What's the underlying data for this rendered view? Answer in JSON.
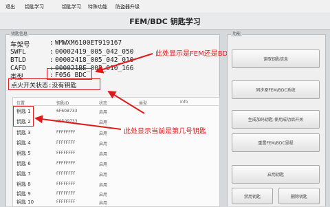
{
  "menu": {
    "item0": "退出",
    "item1": "钥匙学习",
    "item2": "钥匙学习",
    "item3": "特殊功能",
    "item4": "防盗器升级"
  },
  "window": {
    "title": "FEM/BDC 钥匙学习"
  },
  "info_group": {
    "label": "钥匙信息",
    "rows": [
      {
        "label": "车架号",
        "value": "WMWXM6100ET919167"
      },
      {
        "label": "SWFL",
        "value": "00002419_005_042_050"
      },
      {
        "label": "BTLD",
        "value": "00002418_005_042_010"
      },
      {
        "label": "CAFD",
        "value": "000021BE_005_010_166"
      },
      {
        "label": "类型",
        "value": "F056 BDC"
      }
    ],
    "switch_status": "点火开关状态:没有钥匙"
  },
  "key_table": {
    "headers": [
      "位置",
      "钥匙ID",
      "状态",
      "类型",
      "Info"
    ],
    "rows": [
      {
        "pos": "钥匙 1",
        "id": "6F60B733",
        "status": "启用"
      },
      {
        "pos": "钥匙 2",
        "id": "49509733",
        "status": "启用"
      },
      {
        "pos": "钥匙 3",
        "id": "FFFFFFFF",
        "status": "启用"
      },
      {
        "pos": "钥匙 4",
        "id": "FFFFFFFF",
        "status": "启用"
      },
      {
        "pos": "钥匙 5",
        "id": "FFFFFFFF",
        "status": "启用"
      },
      {
        "pos": "钥匙 6",
        "id": "FFFFFFFF",
        "status": "启用"
      },
      {
        "pos": "钥匙 7",
        "id": "FFFFFFFF",
        "status": "启用"
      },
      {
        "pos": "钥匙 8",
        "id": "FFFFFFFF",
        "status": "启用"
      },
      {
        "pos": "钥匙 9",
        "id": "FFFFFFFF",
        "status": "启用"
      },
      {
        "pos": "钥匙 10",
        "id": "FFFFFFFF",
        "status": "启用"
      }
    ]
  },
  "annotations": {
    "fem_bdc": "此处显示是FEM还是BDC",
    "key_number": "此处显示当前是第几号钥匙"
  },
  "function_group": {
    "label": "功能",
    "buttons": {
      "read_key_info": "读取钥匙信息",
      "sync_fem_bdc": "同步原FEM/BDC系统",
      "gen_key": "生成加码钥匙-使用成功后开关",
      "reset_fem_bdc": "重置FEM/BDC里程",
      "enable_key": "启用钥匙",
      "disable_key": "禁用钥匙",
      "delete_key": "删除钥匙"
    }
  },
  "colors": {
    "annotation_red": "#e01a1a"
  }
}
